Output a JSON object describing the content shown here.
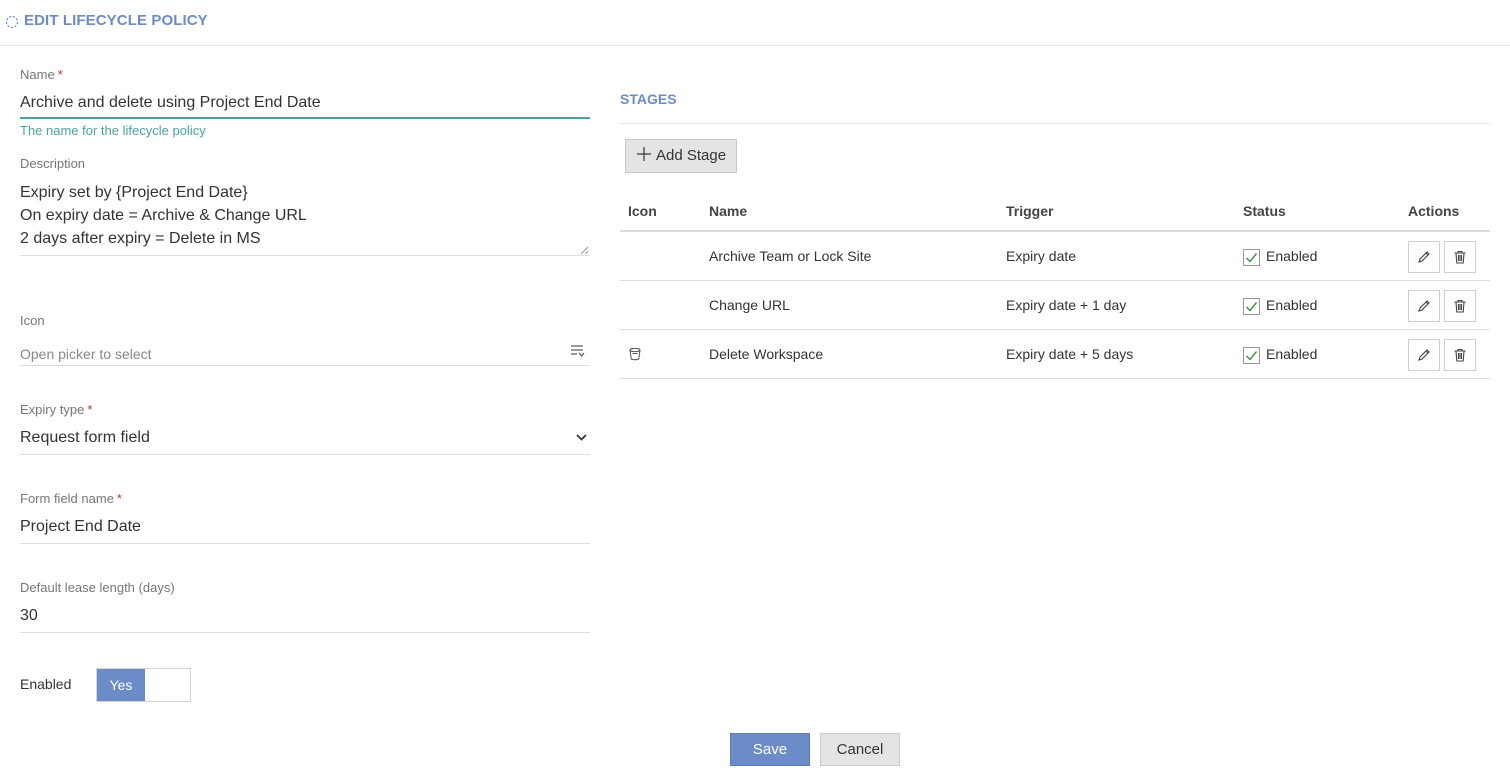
{
  "header": {
    "title": "EDIT LIFECYCLE POLICY"
  },
  "form": {
    "name": {
      "label": "Name",
      "required_mark": "*",
      "value": "Archive and delete using Project End Date",
      "help": "The name for the lifecycle policy"
    },
    "description": {
      "label": "Description",
      "value": "Expiry set by {Project End Date}\nOn expiry date = Archive & Change URL\n2 days after expiry = Delete in MS"
    },
    "icon": {
      "label": "Icon",
      "placeholder": "Open picker to select"
    },
    "expiry_type": {
      "label": "Expiry type",
      "required_mark": "*",
      "value": "Request form field"
    },
    "form_field_name": {
      "label": "Form field name",
      "required_mark": "*",
      "value": "Project End Date"
    },
    "default_lease": {
      "label": "Default lease length (days)",
      "value": "30"
    },
    "enabled": {
      "label": "Enabled",
      "toggle_label": "Yes",
      "value": true
    }
  },
  "stages": {
    "title": "STAGES",
    "add_label": "Add Stage",
    "columns": [
      "Icon",
      "Name",
      "Trigger",
      "Status",
      "Actions"
    ],
    "rows": [
      {
        "icon": "",
        "name": "Archive Team or Lock Site",
        "trigger": "Expiry date",
        "status": "Enabled"
      },
      {
        "icon": "",
        "name": "Change URL",
        "trigger": "Expiry date + 1 day",
        "status": "Enabled"
      },
      {
        "icon": "bucket-icon",
        "name": "Delete Workspace",
        "trigger": "Expiry date + 5 days",
        "status": "Enabled"
      }
    ]
  },
  "footer": {
    "save_label": "Save",
    "cancel_label": "Cancel"
  },
  "colors": {
    "accent": "#6b8cc9",
    "teal": "#4aa3a0",
    "required": "#c0392b",
    "check": "#3a8f3a"
  }
}
